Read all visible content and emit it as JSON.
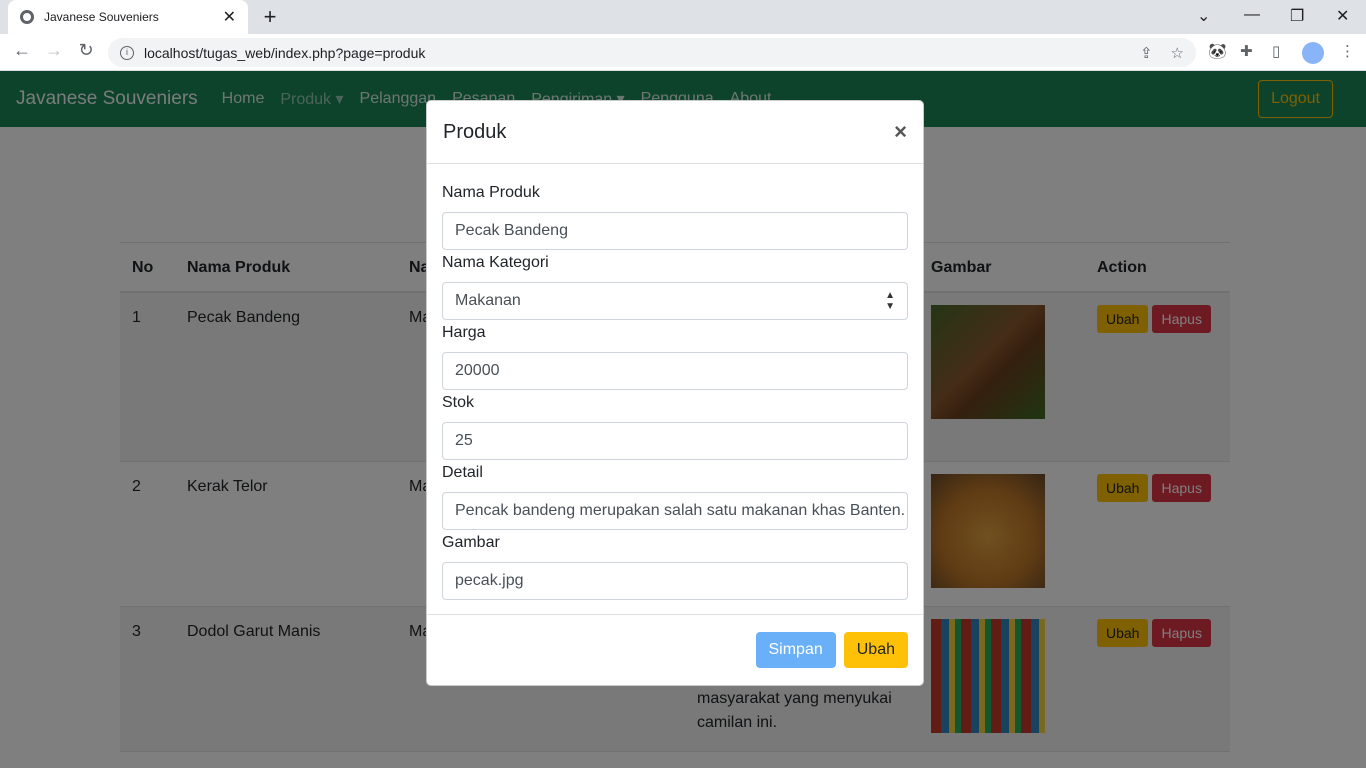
{
  "browser": {
    "tab_title": "Javanese Souveniers",
    "url": "localhost/tugas_web/index.php?page=produk"
  },
  "navbar": {
    "brand": "Javanese Souveniers",
    "links": [
      "Home",
      "Produk",
      "Pelanggan",
      "Pesanan",
      "Pengiriman",
      "Pengguna",
      "About"
    ],
    "logout": "Logout"
  },
  "table": {
    "headers": [
      "No",
      "Nama Produk",
      "Na",
      "Gambar",
      "Action"
    ],
    "rows": [
      {
        "no": "1",
        "name": "Pecak Bandeng",
        "cat": "Ma"
      },
      {
        "no": "2",
        "name": "Kerak Telor",
        "cat": "Ma"
      },
      {
        "no": "3",
        "name": "Dodol Garut Manis",
        "cat": "Ma",
        "detail_tail": "masyarakat yang menyukai",
        "detail_tail2": "camilan ini."
      }
    ],
    "edit_label": "Ubah",
    "delete_label": "Hapus"
  },
  "modal": {
    "title": "Produk",
    "close": "×",
    "fields": {
      "name_label": "Nama Produk",
      "name_value": "Pecak Bandeng",
      "category_label": "Nama Kategori",
      "category_value": "Makanan",
      "price_label": "Harga",
      "price_value": "20000",
      "stock_label": "Stok",
      "stock_value": "25",
      "detail_label": "Detail",
      "detail_value": "Pencak bandeng merupakan salah satu makanan khas Banten.",
      "image_label": "Gambar",
      "image_value": "pecak.jpg"
    },
    "save_label": "Simpan",
    "edit_label": "Ubah"
  }
}
